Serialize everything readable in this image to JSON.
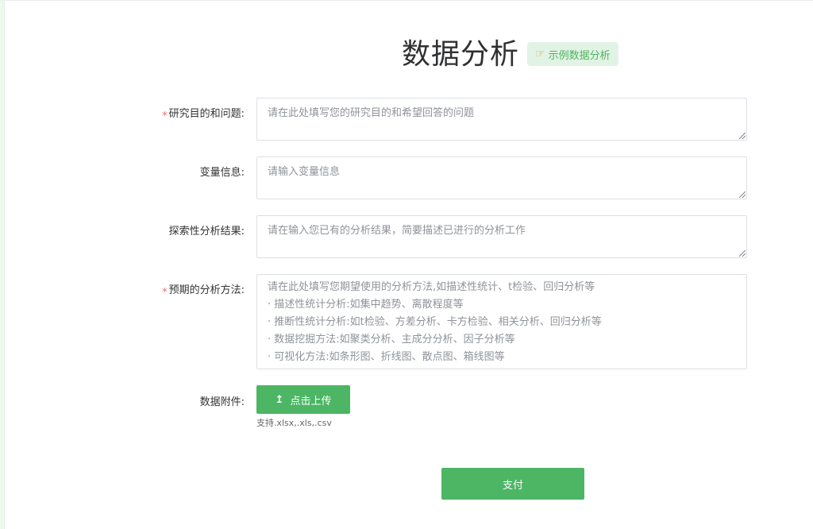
{
  "header": {
    "title": "数据分析",
    "example_button": {
      "label": "示例数据分析",
      "icon": "pointing-hand-icon"
    }
  },
  "form": {
    "research": {
      "label": "研究目的和问题:",
      "required": "*",
      "placeholder": "请在此处填写您的研究目的和希望回答的问题"
    },
    "variables": {
      "label": "变量信息:",
      "placeholder": "请输入变量信息"
    },
    "exploratory": {
      "label": "探索性分析结果:",
      "placeholder": "请在输入您已有的分析结果，简要描述已进行的分析工作"
    },
    "methods": {
      "label": "预期的分析方法:",
      "required": "*",
      "placeholder_lines": [
        "请在此处填写您期望使用的分析方法,如描述性统计、t检验、回归分析等",
        "· 描述性统计分析:如集中趋势、离散程度等",
        "· 推断性统计分析:如t检验、方差分析、卡方检验、相关分析、回归分析等",
        "· 数据挖掘方法:如聚类分析、主成分分析、因子分析等",
        "· 可视化方法:如条形图、折线图、散点图、箱线图等"
      ]
    },
    "attachment": {
      "label": "数据附件:",
      "upload_label": "点击上传",
      "upload_icon": "upload-icon",
      "hint": "支持.xlsx,.xls,.csv"
    },
    "submit_label": "支付"
  },
  "colors": {
    "primary": "#4cb665",
    "required": "#f56c6c",
    "tag_bg": "#e1f3e5"
  }
}
